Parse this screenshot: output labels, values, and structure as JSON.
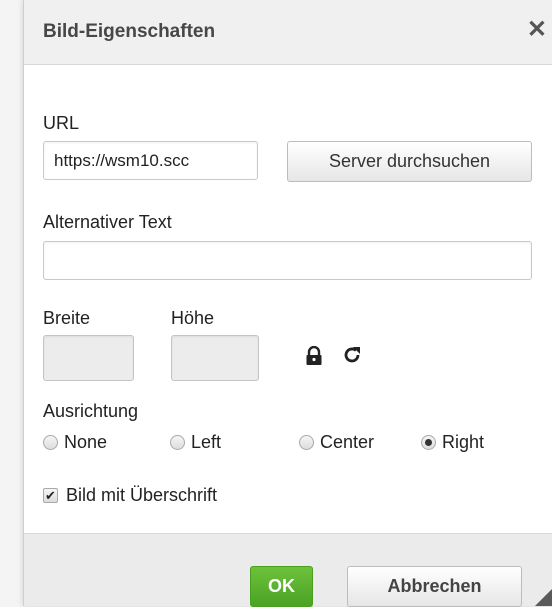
{
  "dialog": {
    "title": "Bild-Eigenschaften",
    "close_icon": "close-icon"
  },
  "form": {
    "url_label": "URL",
    "url_value": "https://wsm10.scc",
    "browse_button": "Server durchsuchen",
    "alt_label": "Alternativer Text",
    "alt_value": "",
    "width_label": "Breite",
    "width_value": "",
    "height_label": "Höhe",
    "height_value": "",
    "lock_icon": "lock-icon",
    "reset_icon": "reset-size-icon",
    "align_label": "Ausrichtung",
    "align_options": [
      {
        "label": "None",
        "checked": false
      },
      {
        "label": "Left",
        "checked": false
      },
      {
        "label": "Center",
        "checked": false
      },
      {
        "label": "Right",
        "checked": true
      }
    ],
    "caption_label": "Bild mit Überschrift",
    "caption_checked": true
  },
  "footer": {
    "ok_label": "OK",
    "cancel_label": "Abbrechen"
  },
  "colors": {
    "ok_green": "#5bb42d",
    "titlebar_bg": "#f0f0f0",
    "footer_bg": "#ebebeb"
  }
}
